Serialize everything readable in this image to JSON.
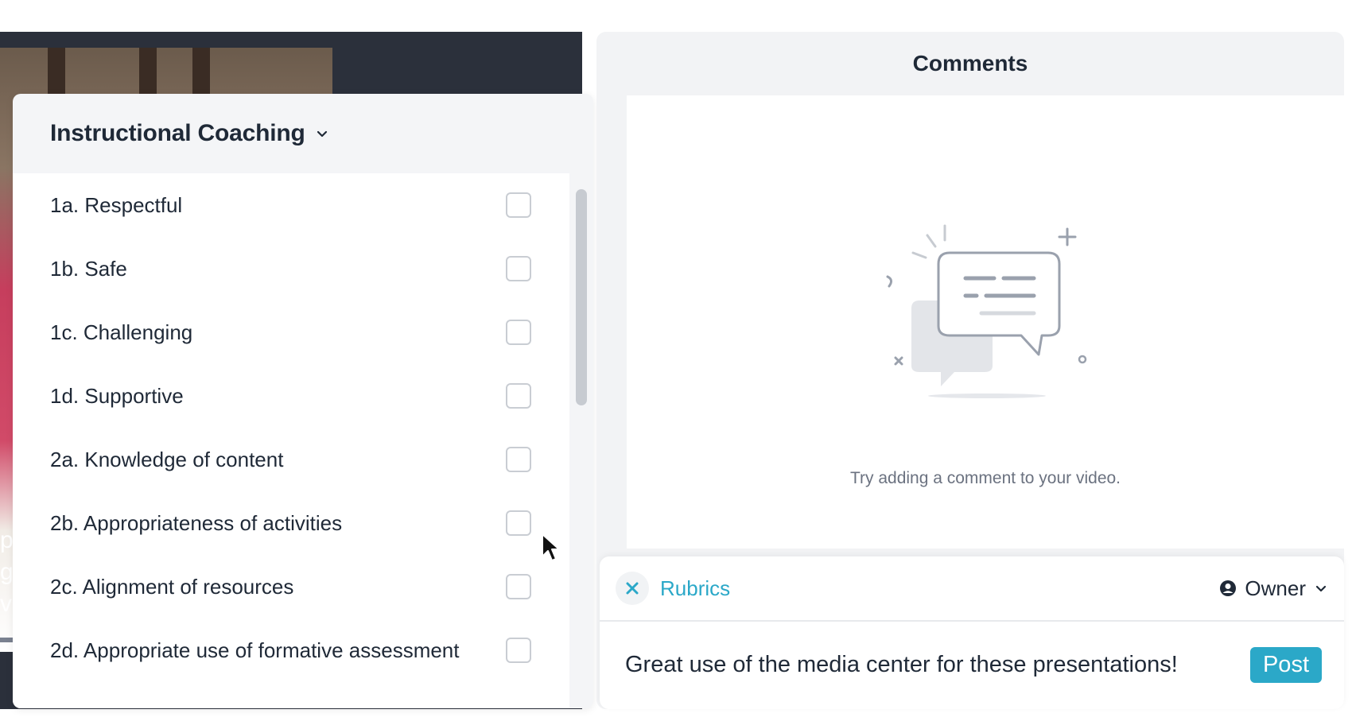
{
  "video": {
    "overlay_lines": [
      "p",
      "g",
      "v"
    ]
  },
  "rubric": {
    "title": "Instructional Coaching",
    "items": [
      {
        "label": "1a. Respectful",
        "checked": false
      },
      {
        "label": "1b. Safe",
        "checked": false
      },
      {
        "label": "1c. Challenging",
        "checked": false
      },
      {
        "label": "1d. Supportive",
        "checked": false
      },
      {
        "label": "2a. Knowledge of content",
        "checked": false
      },
      {
        "label": "2b. Appropriateness of activities",
        "checked": false
      },
      {
        "label": "2c. Alignment of resources",
        "checked": false
      },
      {
        "label": "2d. Appropriate use of formative assessment",
        "checked": false
      }
    ]
  },
  "comments": {
    "title": "Comments",
    "empty_text": "Try adding a comment to your video.",
    "composer": {
      "tag_label": "Rubrics",
      "visibility": "Owner",
      "draft_text": "Great use of the media center for these presentations!",
      "post_label": "Post"
    }
  },
  "colors": {
    "accent": "#2ba8c8",
    "video_bg": "#2b303b",
    "panel_bg": "#f4f5f7"
  }
}
